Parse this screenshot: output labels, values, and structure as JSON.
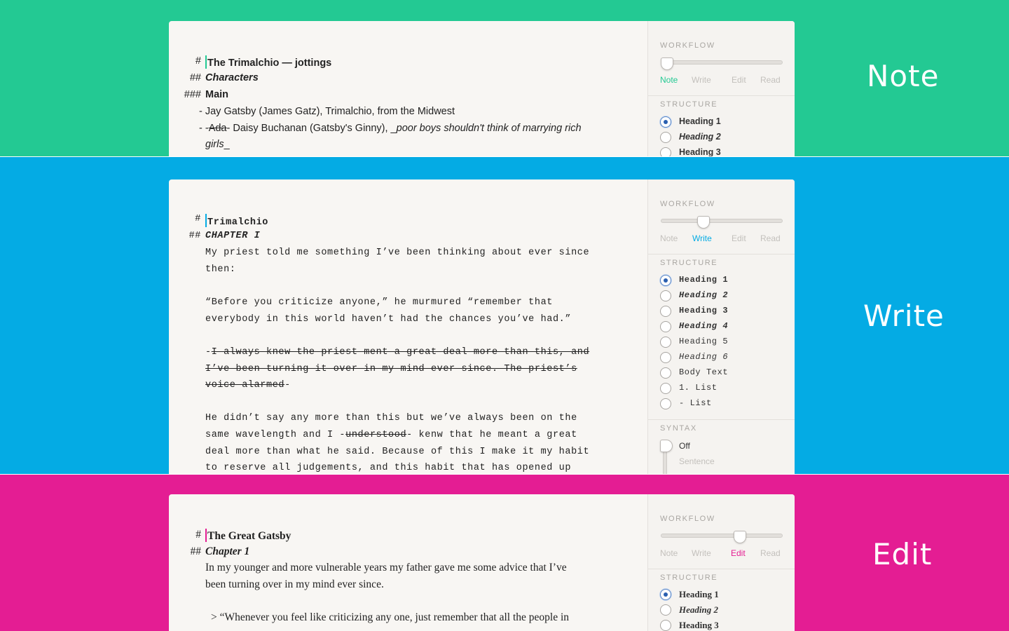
{
  "colors": {
    "note": "#23c993",
    "write": "#04abe4",
    "edit": "#e41d93",
    "cursor_note": "#23c993",
    "cursor_write": "#04abe4",
    "cursor_edit": "#e41d93"
  },
  "sidebar_common": {
    "workflow_title": "WORKFLOW",
    "structure_title": "STRUCTURE",
    "syntax_title": "SYNTAX",
    "workflow_options": [
      "Note",
      "Write",
      "Edit",
      "Read"
    ]
  },
  "note": {
    "mode_label": "Note",
    "workflow_selected": "Note",
    "workflow_position": 0,
    "editor": {
      "l1_marker": "#",
      "l1_text": "The Trimalchio — jottings",
      "l2_marker": "##",
      "l2_text": "Characters",
      "l3_marker": "###",
      "l3_text": "Main",
      "l4_text": "- Jay Gatsby (James Gatz), Trimalchio, from the Midwest",
      "l5_prefix": "- -",
      "l5_struck": "Ada",
      "l5_mid": "- Daisy Buchanan (Gatsby's Ginny), _",
      "l5_italic": "poor boys shouldn't think of marrying rich",
      "l6_italic": "girls",
      "l6_suffix": "_"
    },
    "structure": [
      {
        "label": "Heading 1",
        "checked": true
      },
      {
        "label": "Heading 2",
        "checked": false
      },
      {
        "label": "Heading 3",
        "checked": false
      }
    ]
  },
  "write": {
    "mode_label": "Write",
    "workflow_selected": "Write",
    "workflow_position": 0.33,
    "editor": {
      "l1_marker": "#",
      "l1_text": "Trimalchio",
      "l2_marker": "##",
      "l2_text": "CHAPTER I",
      "p1a": "My priest told me something I’ve been thinking about ever since",
      "p1b": "then:",
      "p2a": "“Before you criticize anyone,” he murmured “remember that",
      "p2b": "everybody in this world haven’t had the chances you’ve had.”",
      "p3a_prefix": "-",
      "p3a": "I always knew the priest ment a great deal more than this, and",
      "p3b": "I’ve been turning it over in my mind ever since. The priest’s",
      "p3c": "voice alarmed",
      "p3c_suffix": "-",
      "p4a": "He didn’t say any more than this but we’ve always been on the",
      "p4b_prefix": "same wavelength and I -",
      "p4b_struck": "understood",
      "p4b_suffix": "- kenw that he meant a great",
      "p4c": "deal more than what he said. Because of this I make it my habit",
      "p4d": "to reserve all judgements, and this habit that has opened up"
    },
    "structure": [
      {
        "label": "Heading 1",
        "checked": true
      },
      {
        "label": "Heading 2",
        "checked": false
      },
      {
        "label": "Heading 3",
        "checked": false
      },
      {
        "label": "Heading 4",
        "checked": false
      },
      {
        "label": "Heading 5",
        "checked": false
      },
      {
        "label": "Heading 6",
        "checked": false
      },
      {
        "label": "Body Text",
        "checked": false
      },
      {
        "label": "1. List",
        "checked": false
      },
      {
        "label": "- List",
        "checked": false
      }
    ],
    "syntax": {
      "options": [
        "Off",
        "Sentence"
      ],
      "selected": "Off"
    }
  },
  "edit": {
    "mode_label": "Edit",
    "workflow_selected": "Edit",
    "workflow_position": 0.67,
    "editor": {
      "l1_marker": "#",
      "l1_text": "The Great Gatsby",
      "l2_marker": "##",
      "l2_text": "Chapter 1",
      "p1a": "In my younger and more vulnerable years my father gave me some advice that I’ve",
      "p1b": "been turning over in my mind ever since.",
      "q1": "> “Whenever you feel like criticizing any one, just remember that all the people in"
    },
    "structure": [
      {
        "label": "Heading 1",
        "checked": true
      },
      {
        "label": "Heading 2",
        "checked": false
      },
      {
        "label": "Heading 3",
        "checked": false
      }
    ]
  }
}
